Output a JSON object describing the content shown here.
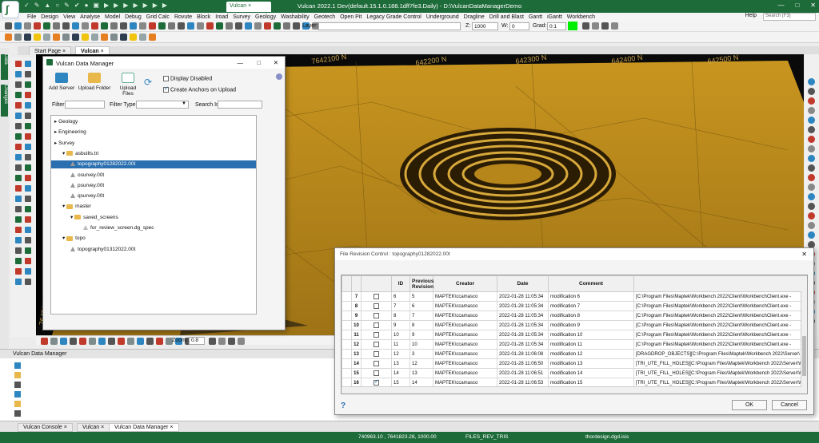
{
  "app": {
    "title": "Vulcan 2022.1 Dev(default.15.1.0.188.1dff7fe3.Daily) - D:\\VulcanDataManagerDemo",
    "tab": "Vulcan",
    "menu": [
      "File",
      "Design",
      "View",
      "Analyse",
      "Model",
      "Debug",
      "Grid Calc",
      "Rovute",
      "Block",
      "Iroad",
      "Survey",
      "Geology",
      "Washability",
      "Geotech",
      "Open Pit",
      "Legacy Grade Control",
      "Underground",
      "Dragline",
      "Drill and Blast",
      "Gantt",
      "iGantt",
      "Workbench"
    ],
    "help": "Help",
    "search_placeholder": "Search (F3)"
  },
  "toolbar": {
    "layer_label": "Layer:",
    "z_label": "Z:",
    "z_value": "1000",
    "w_label": "W:",
    "w_value": "0",
    "grad_label": "Grad:",
    "grad_value": "0:1",
    "swatch_color": "#00ee00"
  },
  "doc_tabs": [
    "Start Page",
    "Vulcan"
  ],
  "side_tabs": [
    "Data",
    "Changes"
  ],
  "viewport": {
    "grid_labels": [
      "7642100 N",
      "642200 N",
      "642300 N",
      "642400 N",
      "642500 N"
    ],
    "side_label": "7642000 N",
    "zoom_label": "Zoom:",
    "zoom_value": "0.8"
  },
  "data_manager": {
    "title": "Vulcan Data Manager",
    "buttons": [
      "Add Server",
      "Upload Folder",
      "Upload Files"
    ],
    "display_disabled": "Display Disabled",
    "create_anchors": "Create Anchors on Upload",
    "filter_label": "Filter",
    "filter_type_label": "Filter Type",
    "search_in_label": "Search In",
    "tree": [
      {
        "label": "Geology",
        "kind": "folder-root",
        "level": 0
      },
      {
        "label": "Engineering",
        "kind": "folder-root",
        "level": 0
      },
      {
        "label": "Survey",
        "kind": "folder-root",
        "level": 0
      },
      {
        "label": "asbuilts.tri",
        "kind": "folder",
        "level": 1
      },
      {
        "label": "topography01282022.00t",
        "kind": "file",
        "level": 2,
        "selected": true
      },
      {
        "label": "osurvey.00t",
        "kind": "file",
        "level": 2
      },
      {
        "label": "psurvey.00t",
        "kind": "file",
        "level": 2
      },
      {
        "label": "qsurvey.00t",
        "kind": "file",
        "level": 2
      },
      {
        "label": "master",
        "kind": "folder",
        "level": 1
      },
      {
        "label": "saved_screens",
        "kind": "folder",
        "level": 2
      },
      {
        "label": "for_review_screen.dg_spec",
        "kind": "plainfile",
        "level": 3
      },
      {
        "label": "topo",
        "kind": "folder",
        "level": 1
      },
      {
        "label": "topography01312022.00t",
        "kind": "file",
        "level": 2
      }
    ]
  },
  "revision_control": {
    "title": "File Revision Control : topography01282022.00t",
    "columns": [
      "ID",
      "Previous Revision",
      "Creator",
      "Date",
      "Comment"
    ],
    "rows": [
      {
        "row": "7",
        "checked": false,
        "id": "6",
        "prev": "5",
        "creator": "MAPTEK\\ccamasco",
        "date": "2022-01-28 11:05:34",
        "comment": "modification 6",
        "path": "[C:\\Program Files\\Maptek\\Workbench 2022\\Client\\WorkbenchClient.exe -"
      },
      {
        "row": "8",
        "checked": false,
        "id": "7",
        "prev": "6",
        "creator": "MAPTEK\\ccamasco",
        "date": "2022-01-28 11:05:34",
        "comment": "modification 7",
        "path": "[C:\\Program Files\\Maptek\\Workbench 2022\\Client\\WorkbenchClient.exe -"
      },
      {
        "row": "9",
        "checked": false,
        "id": "8",
        "prev": "7",
        "creator": "MAPTEK\\ccamasco",
        "date": "2022-01-28 11:05:34",
        "comment": "modification 8",
        "path": "[C:\\Program Files\\Maptek\\Workbench 2022\\Client\\WorkbenchClient.exe -"
      },
      {
        "row": "10",
        "checked": false,
        "id": "9",
        "prev": "8",
        "creator": "MAPTEK\\ccamasco",
        "date": "2022-01-28 11:05:34",
        "comment": "modification 9",
        "path": "[C:\\Program Files\\Maptek\\Workbench 2022\\Client\\WorkbenchClient.exe -"
      },
      {
        "row": "11",
        "checked": false,
        "id": "10",
        "prev": "9",
        "creator": "MAPTEK\\ccamasco",
        "date": "2022-01-28 11:05:34",
        "comment": "modification 10",
        "path": "[C:\\Program Files\\Maptek\\Workbench 2022\\Client\\WorkbenchClient.exe -"
      },
      {
        "row": "12",
        "checked": false,
        "id": "11",
        "prev": "10",
        "creator": "MAPTEK\\ccamasco",
        "date": "2022-01-28 11:05:34",
        "comment": "modification 11",
        "path": "[C:\\Program Files\\Maptek\\Workbench 2022\\Client\\WorkbenchClient.exe -"
      },
      {
        "row": "13",
        "checked": false,
        "id": "12",
        "prev": "3",
        "creator": "MAPTEK\\ccamasco",
        "date": "2022-01-28 11:06:08",
        "comment": "modification 12",
        "path": "[DRAGDROP_OBJECTS][C:\\Program Files\\Maptek\\Workbench 2022\\Server\\"
      },
      {
        "row": "14",
        "checked": false,
        "id": "13",
        "prev": "12",
        "creator": "MAPTEK\\ccamasco",
        "date": "2022-01-28 11:06:50",
        "comment": "modification 13",
        "path": "[TRI_UTE_FILL_HOLES][C:\\Program Files\\Maptek\\Workbench 2022\\Server\\W"
      },
      {
        "row": "15",
        "checked": false,
        "id": "14",
        "prev": "13",
        "creator": "MAPTEK\\ccamasco",
        "date": "2022-01-28 11:06:51",
        "comment": "modification 14",
        "path": "[TRI_UTE_FILL_HOLES][C:\\Program Files\\Maptek\\Workbench 2022\\Server\\W"
      },
      {
        "row": "16",
        "checked": true,
        "id": "15",
        "prev": "14",
        "creator": "MAPTEK\\ccamasco",
        "date": "2022-01-28 11:06:53",
        "comment": "modification 15",
        "path": "[TRI_UTE_FILL_HOLES][C:\\Program Files\\Maptek\\Workbench 2022\\Server\\W"
      }
    ],
    "ok": "OK",
    "cancel": "Cancel",
    "help_icon": "?"
  },
  "bottom_panel": {
    "title": "Vulcan Data Manager"
  },
  "bottom_tabs": [
    "Vulcan Console",
    "Vulcan",
    "Vulcan Data Manager"
  ],
  "status": {
    "coords": "740963.10 , 7641823.28, 1000.00",
    "mode": "FILES_REV_TRIS",
    "file": "thordesign.dgd.isis"
  },
  "colors": {
    "accent": "#1e6b3a",
    "terrain": "#b7861a",
    "selection": "#2a6fb0"
  }
}
